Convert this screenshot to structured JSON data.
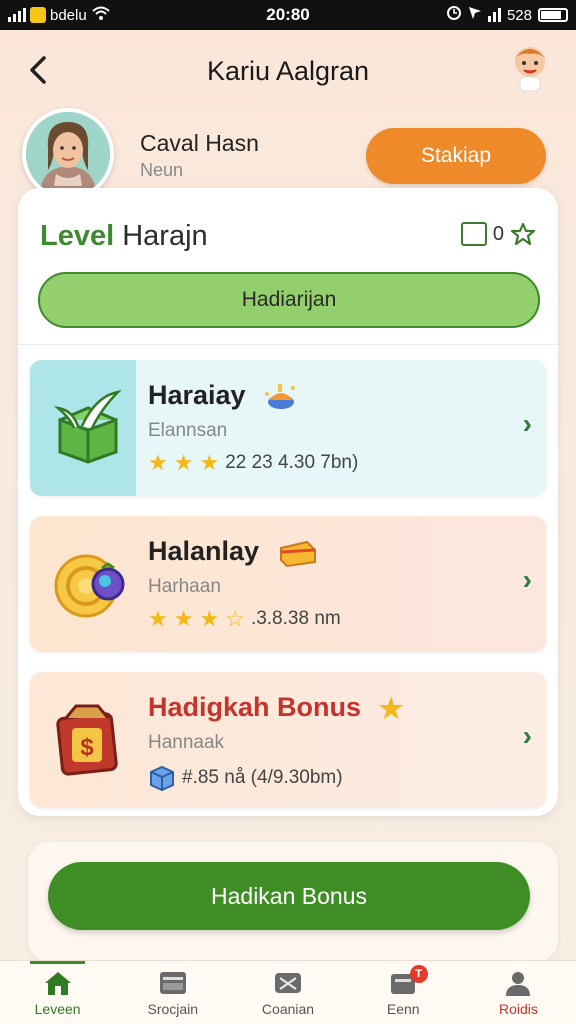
{
  "status_bar": {
    "app_text": "bdelu",
    "time": "20:80",
    "right_text": "528"
  },
  "header": {
    "title": "Kariu Aalgran"
  },
  "profile": {
    "name": "Caval Hasn",
    "subtitle": "Neun",
    "cta_label": "Stakiap"
  },
  "level": {
    "title_accent": "Level",
    "title_rest": "Harajn",
    "meta": "0",
    "progress_label": "Hadiarijan"
  },
  "tiles": [
    {
      "title": "Haraiay",
      "subtitle": "Elannsan",
      "stars": 3,
      "rating_text": "22 23 4.30 7bn)"
    },
    {
      "title": "Halanlay",
      "subtitle": "Harhaan",
      "stars": 4,
      "rating_text": ".3.8.38 nm"
    },
    {
      "title": "Hadigkah Bonus",
      "subtitle": "Hannaak",
      "rating_text": "#.85 nå (4/9.30bm)"
    }
  ],
  "bonus_button": "Hadikan Bonus",
  "nav": [
    {
      "label": "Leveen",
      "icon": "home-icon",
      "active": true
    },
    {
      "label": "Srocjain",
      "icon": "window-icon"
    },
    {
      "label": "Coanian",
      "icon": "mail-icon"
    },
    {
      "label": "Eenn",
      "icon": "notification-icon",
      "badge": "T"
    },
    {
      "label": "Roidis",
      "icon": "profile-icon"
    }
  ],
  "colors": {
    "accent_green": "#3f8d25",
    "accent_orange": "#ef8a2b",
    "bonus_red": "#c4342c",
    "star_gold": "#f2b81b"
  }
}
